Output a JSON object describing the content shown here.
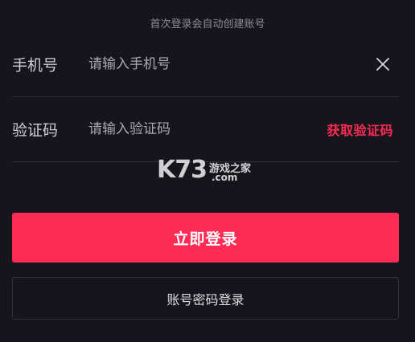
{
  "notice": "首次登录会自动创建账号",
  "phone_field": {
    "label": "手机号",
    "placeholder": "请输入手机号",
    "value": "",
    "clear_icon": "close-icon"
  },
  "code_field": {
    "label": "验证码",
    "placeholder": "请输入验证码",
    "value": "",
    "get_code_label": "获取验证码"
  },
  "watermark": {
    "logo": "K73",
    "text": "游戏之家",
    "domain": ".com"
  },
  "buttons": {
    "login_label": "立即登录",
    "password_login_label": "账号密码登录"
  },
  "colors": {
    "background": "#16151c",
    "accent": "#fe2c55",
    "divider": "#2e2d35",
    "muted_text": "#8e8d95"
  }
}
